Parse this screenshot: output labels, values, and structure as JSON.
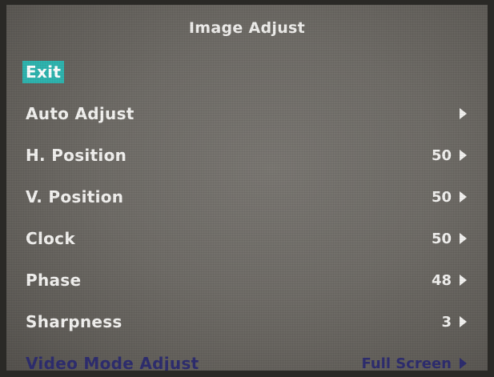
{
  "menu": {
    "title": "Image Adjust",
    "items": [
      {
        "label": "Exit",
        "value": "",
        "selected": true
      },
      {
        "label": "Auto Adjust",
        "value": ""
      },
      {
        "label": "H. Position",
        "value": "50"
      },
      {
        "label": "V. Position",
        "value": "50"
      },
      {
        "label": "Clock",
        "value": "50"
      },
      {
        "label": "Phase",
        "value": "48"
      },
      {
        "label": "Sharpness",
        "value": "3"
      },
      {
        "label": "Video Mode Adjust",
        "value": "Full Screen"
      }
    ]
  },
  "colors": {
    "selected_highlight": "#2fb5b0",
    "accent_text": "#2e2d6f",
    "text": "#f4f3f1"
  },
  "icons": {
    "submenu_arrow": "right-triangle-icon"
  }
}
